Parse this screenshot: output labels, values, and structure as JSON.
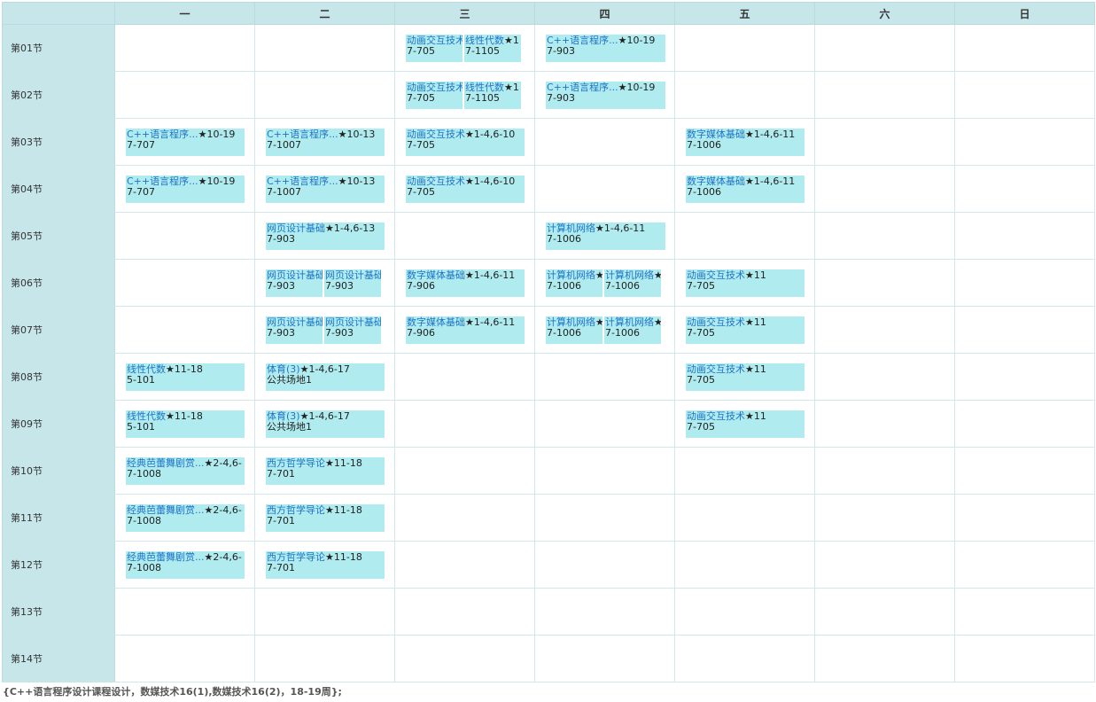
{
  "days": [
    "一",
    "二",
    "三",
    "四",
    "五",
    "六",
    "日"
  ],
  "periods": [
    "第01节",
    "第02节",
    "第03节",
    "第04节",
    "第05节",
    "第06节",
    "第07节",
    "第08节",
    "第09节",
    "第10节",
    "第11节",
    "第12节",
    "第13节",
    "第14节"
  ],
  "colors": {
    "header_bg": "#c6e6ea",
    "block_bg": "#b0ecef",
    "link": "#1e73c8"
  },
  "schedule": [
    [
      [],
      [],
      [
        {
          "title": "动画交互技术",
          "weeks": "",
          "room": "7-705"
        },
        {
          "title": "线性代数",
          "weeks": "★1",
          "room": "7-1105"
        }
      ],
      [
        {
          "title": "C++语言程序...",
          "weeks": "★10-19",
          "room": "7-903"
        }
      ],
      [],
      [],
      []
    ],
    [
      [],
      [],
      [
        {
          "title": "动画交互技术",
          "weeks": "",
          "room": "7-705"
        },
        {
          "title": "线性代数",
          "weeks": "★1",
          "room": "7-1105"
        }
      ],
      [
        {
          "title": "C++语言程序...",
          "weeks": "★10-19",
          "room": "7-903"
        }
      ],
      [],
      [],
      []
    ],
    [
      [
        {
          "title": "C++语言程序...",
          "weeks": "★10-19",
          "room": "7-707"
        }
      ],
      [
        {
          "title": "C++语言程序...",
          "weeks": "★10-13",
          "room": "7-1007"
        }
      ],
      [
        {
          "title": "动画交互技术",
          "weeks": "★1-4,6-10",
          "room": "7-705"
        }
      ],
      [],
      [
        {
          "title": "数字媒体基础",
          "weeks": "★1-4,6-11",
          "room": "7-1006"
        }
      ],
      [],
      []
    ],
    [
      [
        {
          "title": "C++语言程序...",
          "weeks": "★10-19",
          "room": "7-707"
        }
      ],
      [
        {
          "title": "C++语言程序...",
          "weeks": "★10-13",
          "room": "7-1007"
        }
      ],
      [
        {
          "title": "动画交互技术",
          "weeks": "★1-4,6-10",
          "room": "7-705"
        }
      ],
      [],
      [
        {
          "title": "数字媒体基础",
          "weeks": "★1-4,6-11",
          "room": "7-1006"
        }
      ],
      [],
      []
    ],
    [
      [],
      [
        {
          "title": "网页设计基础",
          "weeks": "★1-4,6-13",
          "room": "7-903"
        }
      ],
      [],
      [
        {
          "title": "计算机网络",
          "weeks": "★1-4,6-11",
          "room": "7-1006"
        }
      ],
      [],
      [],
      []
    ],
    [
      [],
      [
        {
          "title": "网页设计基础",
          "weeks": "",
          "room": "7-903"
        },
        {
          "title": "网页设计基础",
          "weeks": "",
          "room": "7-903"
        }
      ],
      [
        {
          "title": "数字媒体基础",
          "weeks": "★1-4,6-11",
          "room": "7-906"
        }
      ],
      [
        {
          "title": "计算机网络",
          "weeks": "★",
          "room": "7-1006"
        },
        {
          "title": "计算机网络",
          "weeks": "★",
          "room": "7-1006"
        }
      ],
      [
        {
          "title": "动画交互技术",
          "weeks": "★11",
          "room": "7-705"
        }
      ],
      [],
      []
    ],
    [
      [],
      [
        {
          "title": "网页设计基础",
          "weeks": "",
          "room": "7-903"
        },
        {
          "title": "网页设计基础",
          "weeks": "",
          "room": "7-903"
        }
      ],
      [
        {
          "title": "数字媒体基础",
          "weeks": "★1-4,6-11",
          "room": "7-906"
        }
      ],
      [
        {
          "title": "计算机网络",
          "weeks": "★",
          "room": "7-1006"
        },
        {
          "title": "计算机网络",
          "weeks": "★",
          "room": "7-1006"
        }
      ],
      [
        {
          "title": "动画交互技术",
          "weeks": "★11",
          "room": "7-705"
        }
      ],
      [],
      []
    ],
    [
      [
        {
          "title": "线性代数",
          "weeks": "★11-18",
          "room": "5-101"
        }
      ],
      [
        {
          "title": "体育(3)",
          "weeks": "★1-4,6-17",
          "room": "公共场地1"
        }
      ],
      [],
      [],
      [
        {
          "title": "动画交互技术",
          "weeks": "★11",
          "room": "7-705"
        }
      ],
      [],
      []
    ],
    [
      [
        {
          "title": "线性代数",
          "weeks": "★11-18",
          "room": "5-101"
        }
      ],
      [
        {
          "title": "体育(3)",
          "weeks": "★1-4,6-17",
          "room": "公共场地1"
        }
      ],
      [],
      [],
      [
        {
          "title": "动画交互技术",
          "weeks": "★11",
          "room": "7-705"
        }
      ],
      [],
      []
    ],
    [
      [
        {
          "title": "经典芭蕾舞剧赏...",
          "weeks": "★2-4,6-",
          "room": "7-1008"
        }
      ],
      [
        {
          "title": "西方哲学导论",
          "weeks": "★11-18",
          "room": "7-701"
        }
      ],
      [],
      [],
      [],
      [],
      []
    ],
    [
      [
        {
          "title": "经典芭蕾舞剧赏...",
          "weeks": "★2-4,6-",
          "room": "7-1008"
        }
      ],
      [
        {
          "title": "西方哲学导论",
          "weeks": "★11-18",
          "room": "7-701"
        }
      ],
      [],
      [],
      [],
      [],
      []
    ],
    [
      [
        {
          "title": "经典芭蕾舞剧赏...",
          "weeks": "★2-4,6-",
          "room": "7-1008"
        }
      ],
      [
        {
          "title": "西方哲学导论",
          "weeks": "★11-18",
          "room": "7-701"
        }
      ],
      [],
      [],
      [],
      [],
      []
    ],
    [
      [],
      [],
      [],
      [],
      [],
      [],
      []
    ],
    [
      [],
      [],
      [],
      [],
      [],
      [],
      []
    ]
  ],
  "footnote": "{C++语言程序设计课程设计，数媒技术16(1),数媒技术16(2)，18-19周};"
}
